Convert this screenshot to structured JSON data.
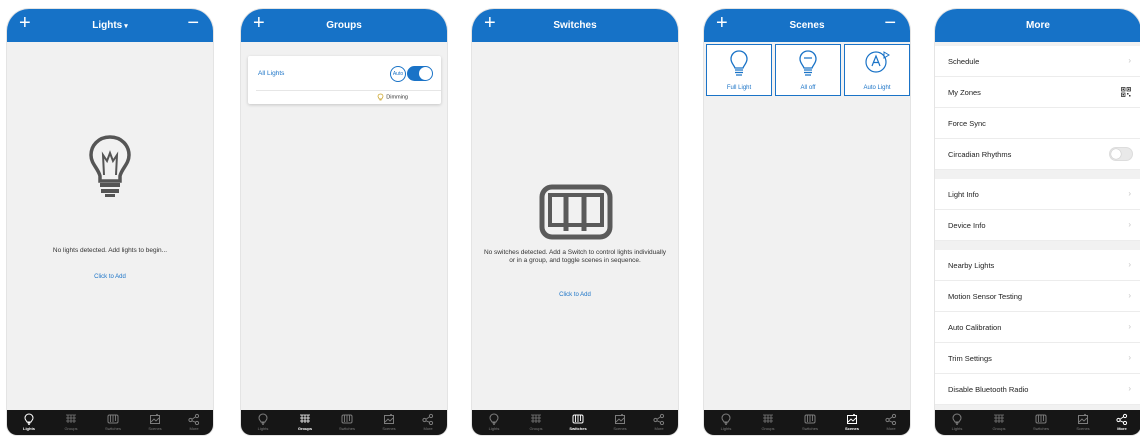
{
  "accent_color": "#1672c7",
  "tabs": [
    {
      "label": "Lights",
      "icon": "bulb-icon"
    },
    {
      "label": "Groups",
      "icon": "groups-icon"
    },
    {
      "label": "Switches",
      "icon": "switch-icon"
    },
    {
      "label": "Scenes",
      "icon": "scenes-icon"
    },
    {
      "label": "More",
      "icon": "share-icon"
    }
  ],
  "screens": {
    "lights": {
      "header": {
        "title": "Lights",
        "plus": "+",
        "minus": "−"
      },
      "empty_message": "No lights detected. Add lights to begin...",
      "add_link": "Click to Add"
    },
    "groups": {
      "header": {
        "title": "Groups",
        "plus": "+"
      },
      "group": {
        "name": "All Lights",
        "auto_label": "Auto",
        "toggle_on": true,
        "dimming_label": "Dimming"
      }
    },
    "switches": {
      "header": {
        "title": "Switches",
        "plus": "+"
      },
      "empty_message": "No switches detected. Add a Switch to control lights individually or in a group, and toggle scenes in sequence.",
      "add_link": "Click to Add"
    },
    "scenes": {
      "header": {
        "title": "Scenes",
        "plus": "+",
        "minus": "−"
      },
      "items": [
        {
          "label": "Full Light",
          "icon": "bulb-on-icon"
        },
        {
          "label": "All off",
          "icon": "bulb-off-icon"
        },
        {
          "label": "Auto Light",
          "icon": "auto-light-icon"
        }
      ]
    },
    "more": {
      "header": {
        "title": "More"
      },
      "rows": [
        {
          "label": "Schedule",
          "accessory": "chevron"
        },
        {
          "label": "My Zones",
          "accessory": "qr"
        },
        {
          "label": "Force Sync",
          "accessory": "none"
        },
        {
          "label": "Circadian Rhythms",
          "accessory": "switch",
          "on": false
        },
        {
          "label": "Light Info",
          "accessory": "chevron"
        },
        {
          "label": "Device Info",
          "accessory": "chevron"
        },
        {
          "label": "Nearby Lights",
          "accessory": "chevron"
        },
        {
          "label": "Motion Sensor Testing",
          "accessory": "chevron"
        },
        {
          "label": "Auto Calibration",
          "accessory": "chevron"
        },
        {
          "label": "Trim Settings",
          "accessory": "chevron"
        },
        {
          "label": "Disable Bluetooth Radio",
          "accessory": "chevron"
        }
      ],
      "chevron_glyph": "›"
    }
  }
}
